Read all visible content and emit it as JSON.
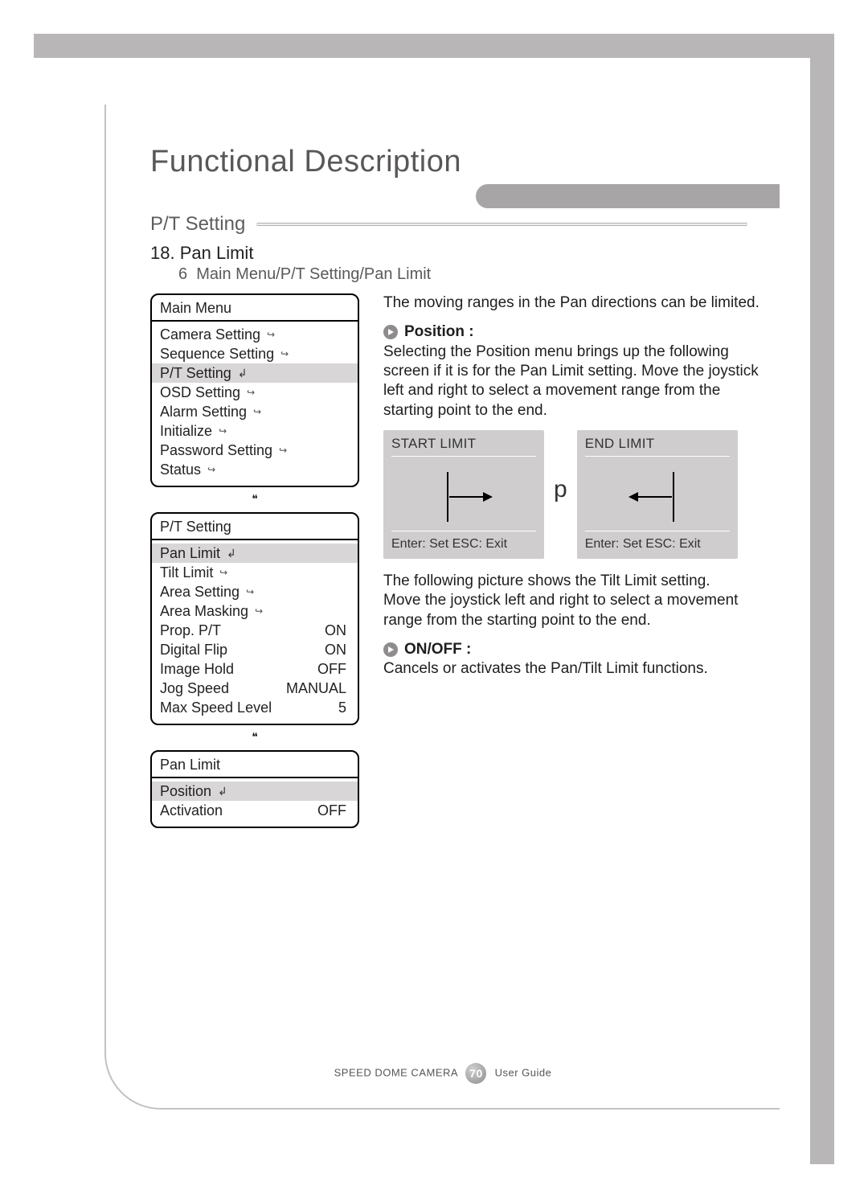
{
  "title": "Functional Description",
  "section": "P/T Setting",
  "sub_number": "18.",
  "sub_title": "Pan Limit",
  "breadcrumb_prefix": "6",
  "breadcrumb": "Main Menu/P/T Setting/Pan Limit",
  "main_menu": {
    "title": "Main Menu",
    "items": [
      {
        "label": "Camera Setting",
        "icon": "submenu",
        "hl": false
      },
      {
        "label": "Sequence Setting",
        "icon": "submenu",
        "hl": false
      },
      {
        "label": "P/T Setting",
        "icon": "enter",
        "hl": true
      },
      {
        "label": "OSD Setting",
        "icon": "submenu",
        "hl": false
      },
      {
        "label": "Alarm Setting",
        "icon": "submenu",
        "hl": false
      },
      {
        "label": "Initialize",
        "icon": "submenu",
        "hl": false
      },
      {
        "label": "Password Setting",
        "icon": "submenu",
        "hl": false
      },
      {
        "label": "Status",
        "icon": "submenu",
        "hl": false
      }
    ]
  },
  "pt_menu": {
    "title": "P/T Setting",
    "items": [
      {
        "label": "Pan Limit",
        "icon": "enter",
        "hl": true,
        "value": ""
      },
      {
        "label": "Tilt Limit",
        "icon": "submenu",
        "hl": false,
        "value": ""
      },
      {
        "label": "Area Setting",
        "icon": "submenu",
        "hl": false,
        "value": ""
      },
      {
        "label": "Area Masking",
        "icon": "submenu",
        "hl": false,
        "value": ""
      },
      {
        "label": "Prop. P/T",
        "icon": "",
        "hl": false,
        "value": "ON"
      },
      {
        "label": "Digital Flip",
        "icon": "",
        "hl": false,
        "value": "ON"
      },
      {
        "label": "Image Hold",
        "icon": "",
        "hl": false,
        "value": "OFF"
      },
      {
        "label": "Jog Speed",
        "icon": "",
        "hl": false,
        "value": "MANUAL"
      },
      {
        "label": "Max Speed Level",
        "icon": "",
        "hl": false,
        "value": "5"
      }
    ]
  },
  "pan_limit_menu": {
    "title": "Pan Limit",
    "items": [
      {
        "label": "Position",
        "icon": "enter",
        "hl": true,
        "value": ""
      },
      {
        "label": "Activation",
        "icon": "",
        "hl": false,
        "value": "OFF"
      }
    ]
  },
  "intro": "The moving ranges in the Pan directions can be limited.",
  "position": {
    "head": "Position :",
    "body": "Selecting the Position menu brings up the following screen if it is for the Pan Limit setting. Move the joystick left and right to select a movement range from the starting point to the end."
  },
  "limit_boxes": {
    "start_title": "START LIMIT",
    "end_title": "END LIMIT",
    "footer": "Enter: Set   ESC: Exit",
    "mid_glyph": "p"
  },
  "tilt_para": "The following picture shows the Tilt Limit setting.\nMove the joystick left and right to select a movement range from the starting point to the end.",
  "onoff": {
    "head": "ON/OFF :",
    "body": "Cancels or activates the Pan/Tilt Limit functions."
  },
  "footer": {
    "left": "SPEED DOME CAMERA",
    "page": "70",
    "right": "User Guide"
  },
  "down_arrow": "❝"
}
